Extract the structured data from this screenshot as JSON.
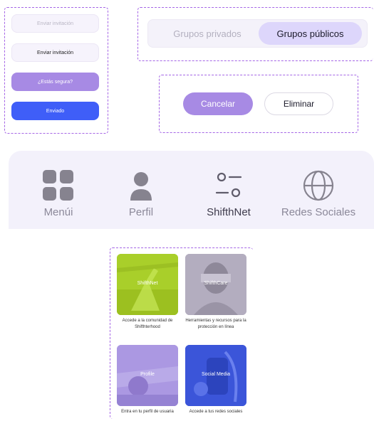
{
  "buttons": {
    "invite_disabled": "Enviar invitación",
    "invite": "Enviar invitación",
    "confirm": "¿Estás segura?",
    "sent": "Enviado"
  },
  "group_tabs": {
    "private": "Grupos privados",
    "public": "Grupos públicos",
    "selected": "Grupos públicos"
  },
  "dialog_actions": {
    "cancel": "Cancelar",
    "delete": "Eliminar"
  },
  "nav": {
    "items": [
      {
        "label": "Menúi",
        "icon": "grid-icon",
        "active": false
      },
      {
        "label": "Perfil",
        "icon": "user-icon",
        "active": false
      },
      {
        "label": "ShifthNet",
        "icon": "sliders-icon",
        "active": true
      },
      {
        "label": "Redes Sociales",
        "icon": "globe-icon",
        "active": false
      }
    ]
  },
  "cards": [
    {
      "title": "ShifthNet",
      "caption": "Accede a la comunidad de Shifthterhood",
      "color": "#a9cf2a"
    },
    {
      "title": "ShifthCare",
      "caption": "Herramientas y recursos para la protección en línea",
      "color": "#a9a3b5"
    },
    {
      "title": "Profile",
      "caption": "Entra en tu perfil de usuaria",
      "color": "#a48fdc"
    },
    {
      "title": "Social Media",
      "caption": "Accede a tus redes sociales",
      "color": "#3b55d9"
    }
  ],
  "colors": {
    "accent_purple": "#a78ae4",
    "accent_blue": "#3f5ef8",
    "selection_bg": "#ddd6fb",
    "guide_border": "#a566e6"
  }
}
